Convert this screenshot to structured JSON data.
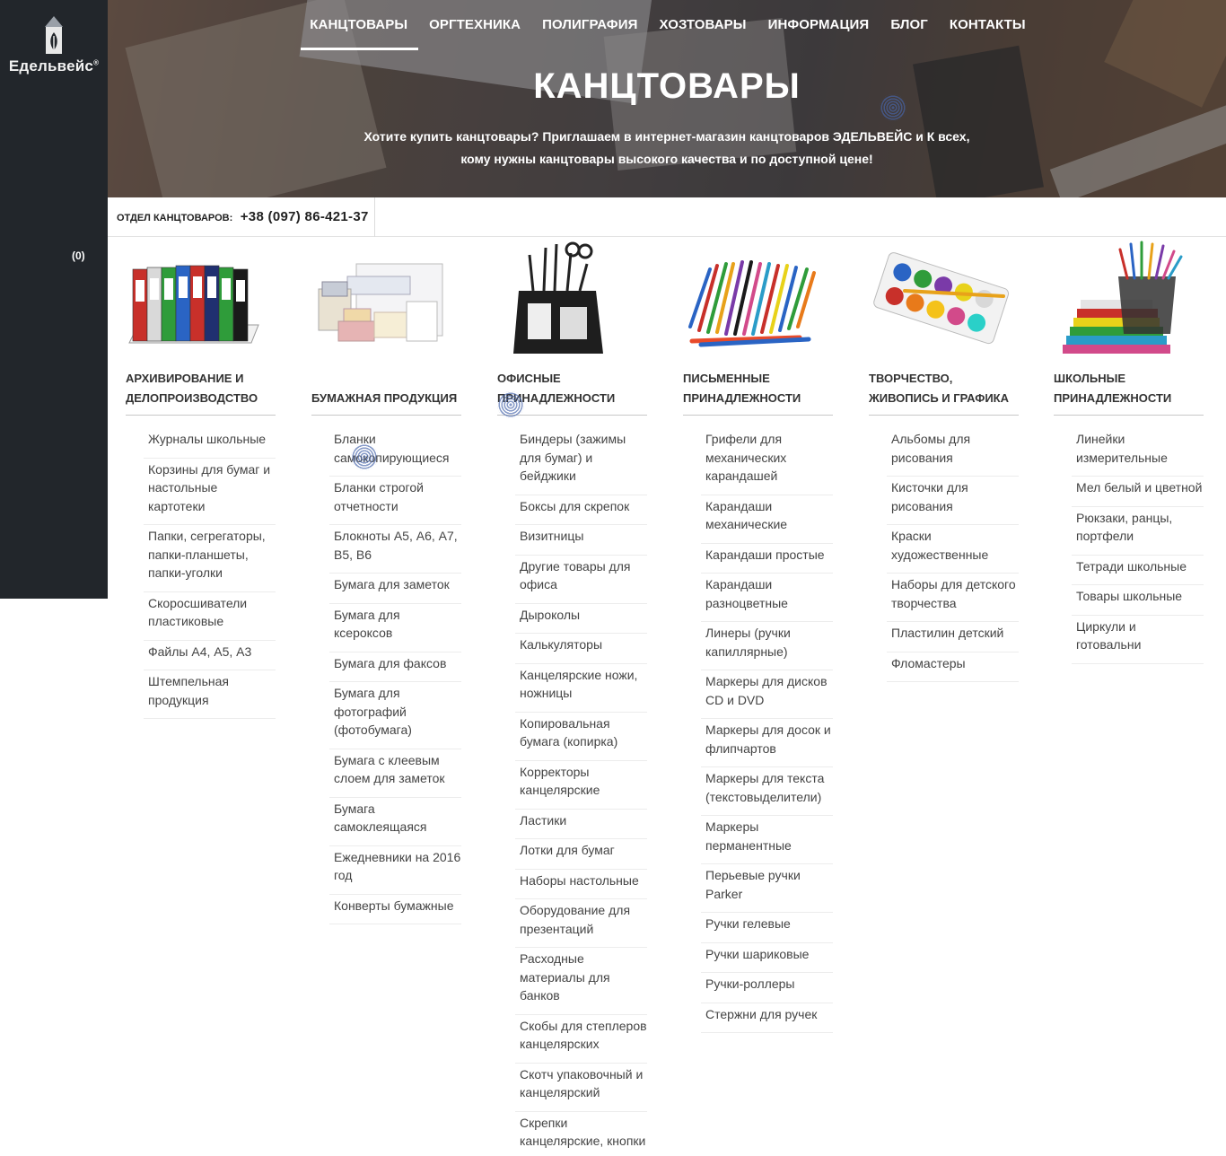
{
  "brand": {
    "name": "Едельвейс",
    "mark": "®"
  },
  "cart": {
    "count": "(0)"
  },
  "nav": [
    {
      "label": "КАНЦТОВАРЫ",
      "active": true
    },
    {
      "label": "ОРГТЕХНИКА"
    },
    {
      "label": "ПОЛИГРАФИЯ"
    },
    {
      "label": "ХОЗТОВАРЫ"
    },
    {
      "label": "ИНФОРМАЦИЯ"
    },
    {
      "label": "БЛОГ"
    },
    {
      "label": "КОНТАКТЫ"
    }
  ],
  "hero": {
    "title": "КАНЦТОВАРЫ",
    "description": "Хотите купить канцтовары? Приглашаем в интернет-магазин канцтоваров ЭДЕЛЬВЕЙС и К всех, кому нужны канцтовары высокого качества и по доступной цене!"
  },
  "phone": {
    "label": "ОТДЕЛ КАНЦТОВАРОВ:",
    "number": "+38 (097) 86-421-37"
  },
  "categories": [
    {
      "title": "АРХИВИРОВАНИЕ И ДЕЛОПРОИЗВОДСТВО",
      "image": "binders-image",
      "items": [
        "Журналы школьные",
        "Корзины для бумаг и настольные картотеки",
        "Папки, сегрегаторы, папки-планшеты, папки-уголки",
        "Скоросшиватели пластиковые",
        "Файлы А4, А5, А3",
        "Штемпельная продукция"
      ]
    },
    {
      "title": "БУМАЖНАЯ ПРОДУКЦИЯ",
      "image": "paper-products-image",
      "items": [
        "Бланки самокопирующиеся",
        "Бланки строгой отчетности",
        "Блокноты А5, А6, А7, В5, В6",
        "Бумага для заметок",
        "Бумага для ксероксов",
        "Бумага для факсов",
        "Бумага для фотографий (фотобумага)",
        "Бумага с клеевым слоем для заметок",
        "Бумага самоклеящаяся",
        "Ежедневники на 2016 год",
        "Конверты бумажные"
      ]
    },
    {
      "title": "ОФИСНЫЕ ПРИНАДЛЕЖНОСТИ",
      "image": "desk-organizer-image",
      "items": [
        "Биндеры (зажимы для бумаг) и бейджики",
        "Боксы для скрепок",
        "Визитницы",
        "Другие товары для офиса",
        "Дыроколы",
        "Калькуляторы",
        "Канцелярские ножи, ножницы",
        "Копировальная бумага (копирка)",
        "Корректоры канцелярские",
        "Ластики",
        "Лотки для бумаг",
        "Наборы настольные",
        "Оборудование для презентаций",
        "Расходные материалы для банков",
        "Скобы для степлеров канцелярских",
        "Скотч упаковочный и канцелярский",
        "Скрепки канцелярские, кнопки"
      ]
    },
    {
      "title": "ПИСЬМЕННЫЕ ПРИНАДЛЕЖНОСТИ",
      "image": "pens-image",
      "items": [
        "Грифели для механических карандашей",
        "Карандаши механические",
        "Карандаши простые",
        "Карандаши разноцветные",
        "Линеры (ручки капиллярные)",
        "Маркеры для дисков CD и DVD",
        "Маркеры для досок и флипчартов",
        "Маркеры для текста (текстовыделители)",
        "Маркеры перманентные",
        "Перьевые ручки Parker",
        "Ручки гелевые",
        "Ручки шариковые",
        "Ручки-роллеры",
        "Стержни для ручек"
      ]
    },
    {
      "title": "ТВОРЧЕСТВО, ЖИВОПИСЬ И ГРАФИКА",
      "image": "watercolor-image",
      "items": [
        "Альбомы для рисования",
        "Кисточки для рисования",
        "Краски художественные",
        "Наборы для детского творчества",
        "Пластилин детский",
        "Фломастеры"
      ]
    },
    {
      "title": "ШКОЛЬНЫЕ ПРИНАДЛЕЖНОСТИ",
      "image": "school-supplies-image",
      "items": [
        "Линейки измерительные",
        "Мел белый и цветной",
        "Рюкзаки, ранцы, портфели",
        "Тетради школьные",
        "Товары школьные",
        "Циркули и готовальни"
      ]
    }
  ]
}
